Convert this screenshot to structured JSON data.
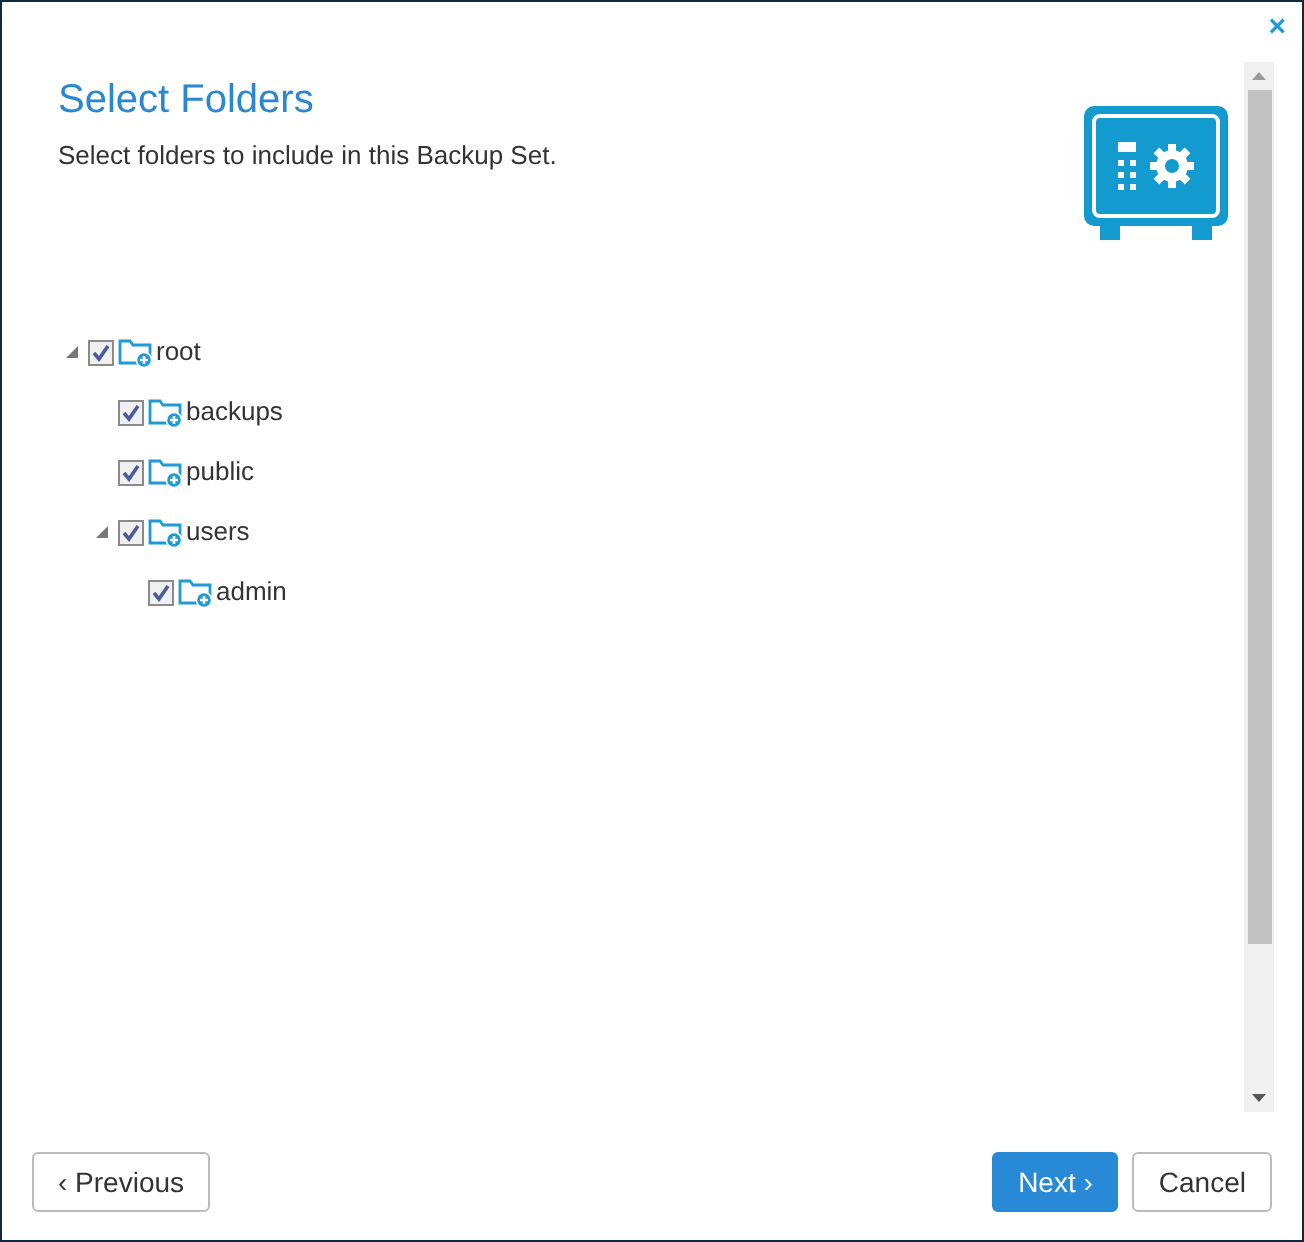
{
  "close": "×",
  "header": {
    "title": "Select Folders",
    "subtitle": "Select folders to include in this Backup Set."
  },
  "tree": [
    {
      "label": "root",
      "checked": true,
      "expanded": true,
      "children": [
        {
          "label": "backups",
          "checked": true
        },
        {
          "label": "public",
          "checked": true
        },
        {
          "label": "users",
          "checked": true,
          "expanded": true,
          "children": [
            {
              "label": "admin",
              "checked": true
            }
          ]
        }
      ]
    }
  ],
  "buttons": [
    {
      "label": "‹ Previous",
      "kind": "secondary"
    },
    {
      "label": "Next ›",
      "kind": "primary"
    },
    {
      "label": "Cancel",
      "kind": "secondary"
    }
  ]
}
